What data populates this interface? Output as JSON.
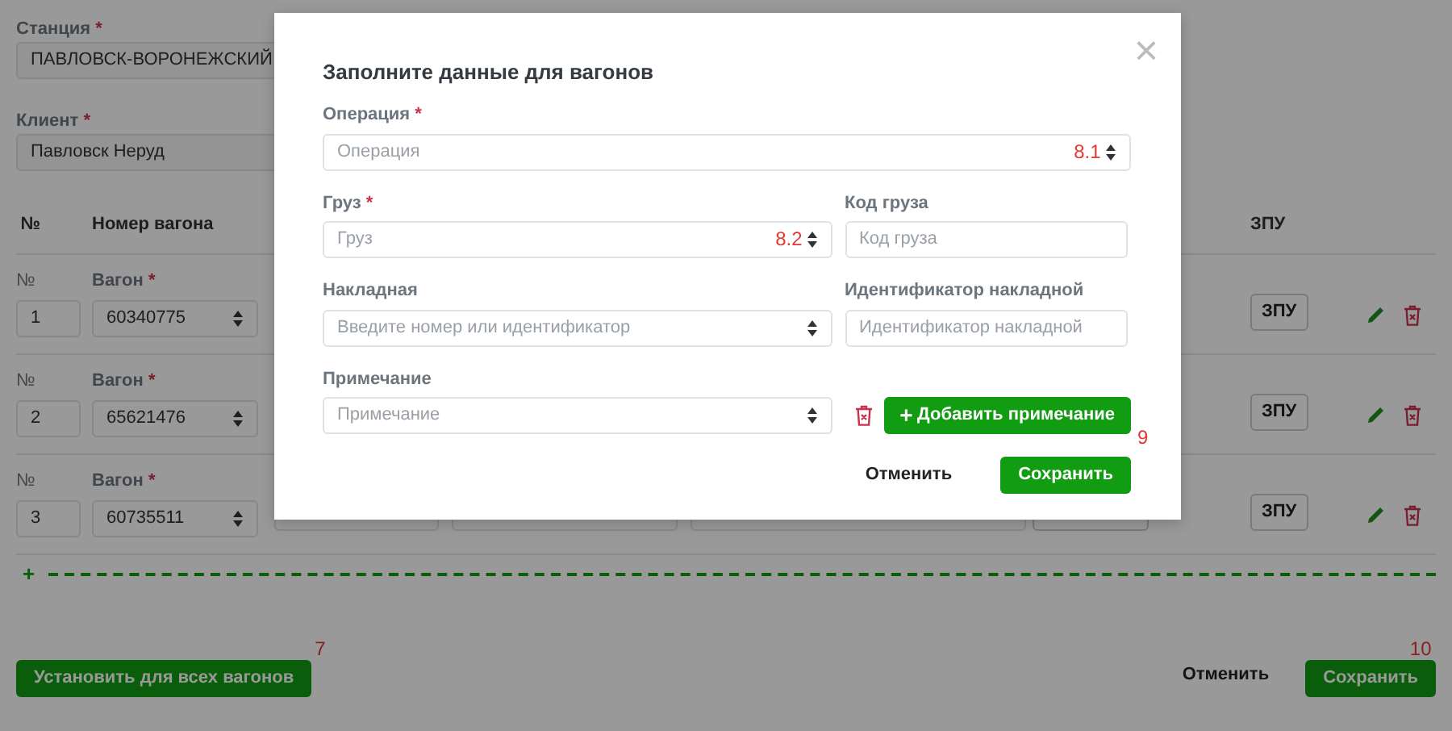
{
  "station": {
    "label": "Станция",
    "required_mark": "*",
    "value": "ПАВЛОВСК-ВОРОНЕЖСКИЙ"
  },
  "client": {
    "label": "Клиент",
    "required_mark": "*",
    "value": "Павловск Неруд"
  },
  "table": {
    "columns": [
      "№",
      "Номер вагона",
      "ЗПУ"
    ],
    "rows": [
      {
        "kind": "short",
        "number_label": "№",
        "number": "1",
        "wagon_label": "Вагон",
        "wagon_required_mark": "*",
        "wagon": "60340775",
        "zpu_button": "ЗПУ"
      },
      {
        "kind": "short",
        "number_label": "№",
        "number": "2",
        "wagon_label": "Вагон",
        "wagon_required_mark": "*",
        "wagon": "65621476",
        "zpu_button": "ЗПУ"
      },
      {
        "kind": "full",
        "number_label": "№",
        "number": "3",
        "wagon_label": "Вагон",
        "wagon_required_mark": "*",
        "wagon": "60735511",
        "zpu_button": "ЗПУ"
      }
    ]
  },
  "add_row_icon": "+",
  "set_all_button": "Установить для всех вагонов",
  "set_all_annotation": "7",
  "cancel_button": "Отменить",
  "save_button": "Сохранить",
  "save_annotation": "10",
  "modal": {
    "title": "Заполните данные для вагонов",
    "close": "×",
    "operation": {
      "label": "Операция",
      "required_mark": "*",
      "placeholder": "Операция",
      "annotation": "8.1"
    },
    "cargo": {
      "label": "Груз",
      "required_mark": "*",
      "placeholder": "Груз",
      "annotation": "8.2"
    },
    "cargo_code": {
      "label": "Код груза",
      "placeholder": "Код груза"
    },
    "waybill": {
      "label": "Накладная",
      "placeholder": "Введите номер или идентификатор"
    },
    "waybill_id": {
      "label": "Идентификатор накладной",
      "placeholder": "Идентификатор накладной"
    },
    "note": {
      "label": "Примечание",
      "placeholder": "Примечание"
    },
    "add_note_button": "Добавить примечание",
    "add_note_icon": "+",
    "cancel_button": "Отменить",
    "save_button": "Сохранить",
    "save_annotation": "9"
  }
}
